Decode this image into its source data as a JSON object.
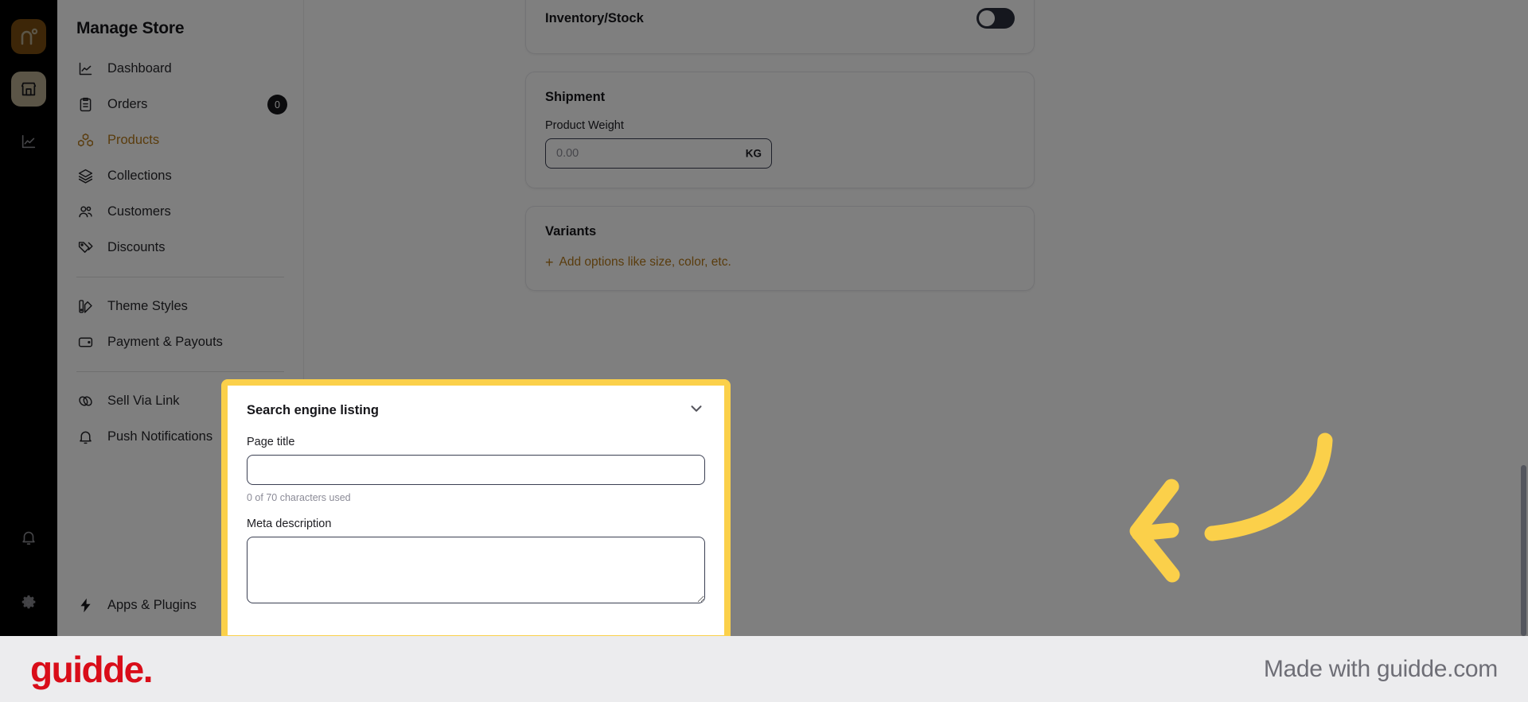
{
  "rail": {
    "logo_icon": "nuvio-brand-logo",
    "logo_color": "#7a4d10",
    "items": [
      {
        "icon": "store-icon",
        "active": true
      },
      {
        "icon": "analytics-chart-icon",
        "active": false
      }
    ],
    "bottom_items": [
      {
        "icon": "bell-icon"
      },
      {
        "icon": "gear-icon"
      }
    ]
  },
  "sidebar": {
    "title": "Manage Store",
    "groups": [
      {
        "items": [
          {
            "label": "Dashboard",
            "icon": "analytics-chart-icon",
            "badge": null,
            "active": false
          },
          {
            "label": "Orders",
            "icon": "clipboard-icon",
            "badge": "0",
            "active": false
          },
          {
            "label": "Products",
            "icon": "boxes-icon",
            "badge": null,
            "active": true
          },
          {
            "label": "Collections",
            "icon": "layers-icon",
            "badge": null,
            "active": false
          },
          {
            "label": "Customers",
            "icon": "users-icon",
            "badge": null,
            "active": false
          },
          {
            "label": "Discounts",
            "icon": "tag-icon",
            "badge": null,
            "active": false
          }
        ]
      },
      {
        "items": [
          {
            "label": "Theme Styles",
            "icon": "palette-icon",
            "badge": null,
            "active": false
          },
          {
            "label": "Payment & Payouts",
            "icon": "wallet-icon",
            "badge": null,
            "active": false
          }
        ]
      },
      {
        "items": [
          {
            "label": "Sell Via Link",
            "icon": "link-icon",
            "badge": null,
            "active": false
          },
          {
            "label": "Push Notifications",
            "icon": "bell-icon",
            "badge": null,
            "active": false
          }
        ]
      }
    ],
    "bottom_item": {
      "label": "Apps & Plugins",
      "icon": "lightning-bolt-icon",
      "chevron": "chevron-right-icon"
    },
    "active_color": "#b5791a"
  },
  "main": {
    "inventory_card": {
      "title": "Inventory/Stock",
      "toggle_state": "off",
      "toggle_name": "inventory-stock-toggle"
    },
    "shipment_card": {
      "title": "Shipment",
      "weight_label": "Product Weight",
      "weight_value": "",
      "weight_placeholder": "0.00",
      "weight_unit": "KG"
    },
    "variants_card": {
      "title": "Variants",
      "add_link": "Add options like size, color, etc.",
      "add_icon": "plus-icon"
    },
    "seo_card": {
      "title": "Search engine listing",
      "collapse_icon": "chevron-down-icon",
      "page_title_label": "Page title",
      "page_title_value": "",
      "page_title_placeholder": "",
      "page_title_counter": "0 of 70 characters used",
      "meta_description_label": "Meta description",
      "meta_description_value": "",
      "meta_description_placeholder": "",
      "highlight_color": "#FBD04A"
    }
  },
  "annotation": {
    "arrow_icon": "curved-arrow-left-icon",
    "arrow_color": "#FBD04A"
  },
  "footer": {
    "logo_text": "guidde.",
    "logo_color": "#d90d19",
    "made_with": "Made with guidde.com"
  }
}
